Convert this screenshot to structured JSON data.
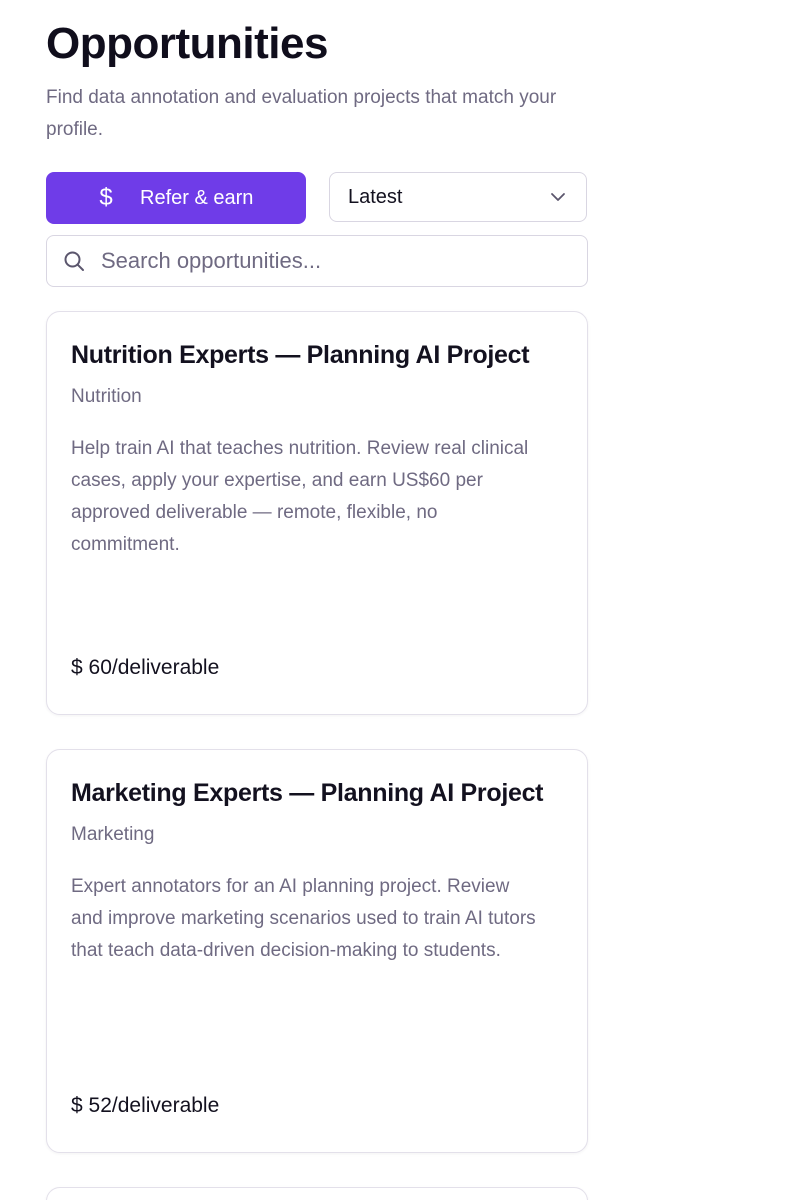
{
  "header": {
    "title": "Opportunities",
    "subtitle": "Find data annotation and evaluation projects that match your profile."
  },
  "toolbar": {
    "refer_icon": "dollar-icon",
    "refer_label": "Refer & earn",
    "sort_selected": "Latest",
    "sort_icon": "chevron-down-icon"
  },
  "search": {
    "placeholder": "Search opportunities...",
    "value": ""
  },
  "colors": {
    "accent": "#6f3ce8",
    "muted_text": "#6f6a82",
    "border": "#d9d6e2"
  },
  "opportunities": [
    {
      "title": "Nutrition Experts — Planning AI Project",
      "category": "Nutrition",
      "description": "Help train AI that teaches nutrition. Review real clinical cases, apply your expertise, and earn US$60 per approved deliverable — remote, flexible, no commitment.",
      "rate": "$ 60/deliverable"
    },
    {
      "title": "Marketing Experts — Planning AI Project",
      "category": "Marketing",
      "description": "Expert annotators for an AI planning project. Review and improve marketing scenarios used to train AI tutors that teach data-driven decision-making to students.",
      "rate": "$ 52/deliverable"
    }
  ]
}
